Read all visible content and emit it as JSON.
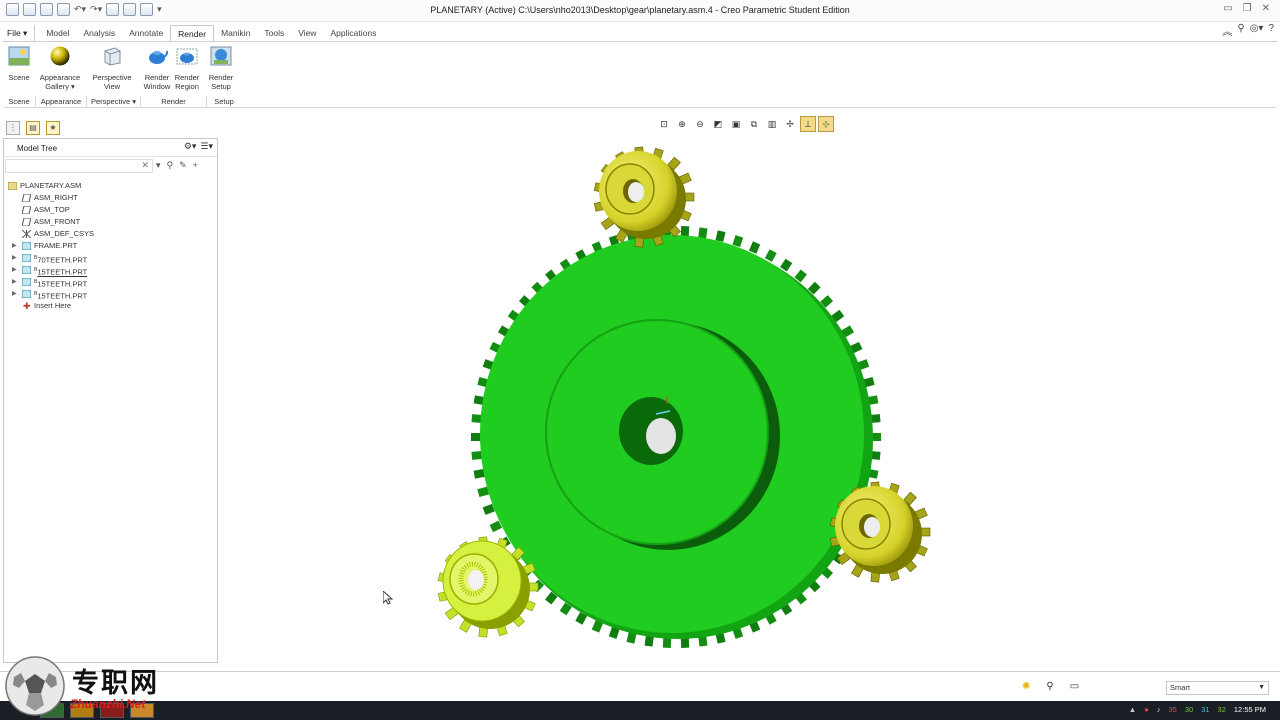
{
  "window": {
    "title": "PLANETARY (Active) C:\\Users\\nho2013\\Desktop\\gear\\planetary.asm.4 - Creo Parametric Student Edition"
  },
  "ribbon_tabs": [
    {
      "label": "File ▾"
    },
    {
      "label": "Model"
    },
    {
      "label": "Analysis"
    },
    {
      "label": "Annotate"
    },
    {
      "label": "Render"
    },
    {
      "label": "Manikin"
    },
    {
      "label": "Tools"
    },
    {
      "label": "View"
    },
    {
      "label": "Applications"
    }
  ],
  "ribbon": {
    "scene": "Scene",
    "appearance_line1": "Appearance",
    "appearance_line2": "Gallery ▾",
    "perspective_line1": "Perspective",
    "perspective_line2": "View",
    "render_window_line1": "Render",
    "render_window_line2": "Window",
    "render_region_line1": "Render",
    "render_region_line2": "Region",
    "render_setup_line1": "Render",
    "render_setup_line2": "Setup",
    "groups": {
      "scene": "Scene",
      "appearance": "Appearance",
      "perspective": "Perspective ▾",
      "render": "Render",
      "setup": "Setup"
    }
  },
  "model_tree": {
    "title": "Model Tree",
    "search_value": "",
    "items": [
      {
        "label": "PLANETARY.ASM",
        "icon": "assembly-icon"
      },
      {
        "label": "ASM_RIGHT",
        "icon": "datum-plane-icon"
      },
      {
        "label": "ASM_TOP",
        "icon": "datum-plane-icon"
      },
      {
        "label": "ASM_FRONT",
        "icon": "datum-plane-icon"
      },
      {
        "label": "ASM_DEF_CSYS",
        "icon": "csys-icon"
      },
      {
        "label": "FRAME.PRT",
        "icon": "part-icon"
      },
      {
        "label": "70TEETH.PRT",
        "icon": "part-icon"
      },
      {
        "label": "15TEETH.PRT",
        "icon": "part-icon"
      },
      {
        "label": "15TEETH.PRT",
        "icon": "part-icon"
      },
      {
        "label": "15TEETH.PRT",
        "icon": "part-icon"
      },
      {
        "label": "Insert Here",
        "icon": "insert-here-icon"
      }
    ]
  },
  "status": {
    "filter_value": "Smart"
  },
  "taskbar": {
    "tray_numbers": [
      "35",
      "30",
      "31",
      "32"
    ],
    "clock": "12:55 PM"
  },
  "watermark": {
    "chinese": "专职网",
    "latin": "Zhuanzhi.Net"
  },
  "colors": {
    "ring_gear": "#1fcc1f",
    "planet_gear": "#d8d838",
    "accent_tab": "#f2dc8c"
  }
}
